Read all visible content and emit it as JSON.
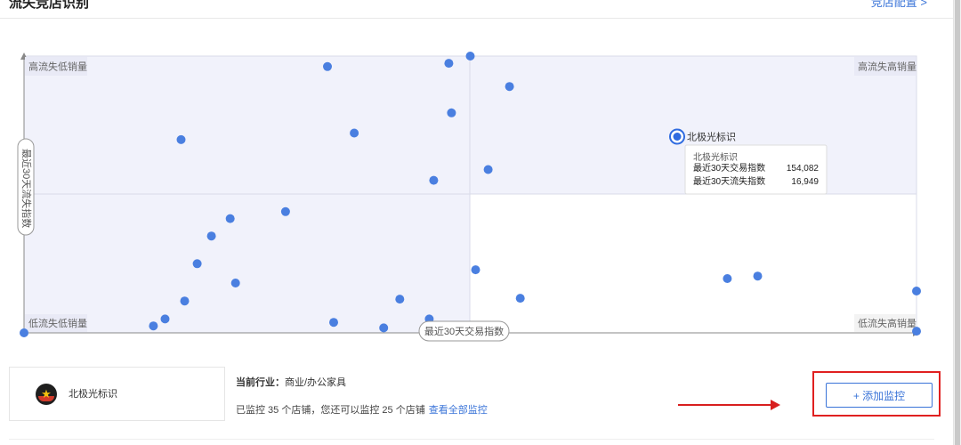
{
  "header": {
    "title": "流失竞店识别",
    "link": "竞店配置 >"
  },
  "chart_data": {
    "type": "scatter",
    "title": "",
    "xlabel": "最近30天交易指数",
    "ylabel": "最近30天流失指数",
    "quadrants": {
      "top_left": "高流失低销量",
      "top_right": "高流失高销量",
      "bottom_left": "低流失低销量",
      "bottom_right": "低流失高销量"
    },
    "colors": {
      "point": "#4a7fe0",
      "quadrant_fill": "#f1f2fb",
      "grid": "#d9dbe8"
    },
    "x_range": [
      0,
      1
    ],
    "y_range": [
      0,
      1
    ],
    "points": [
      {
        "x": 0.0,
        "y": 0.0
      },
      {
        "x": 0.145,
        "y": 0.025
      },
      {
        "x": 0.158,
        "y": 0.05
      },
      {
        "x": 0.18,
        "y": 0.115
      },
      {
        "x": 0.237,
        "y": 0.18
      },
      {
        "x": 0.194,
        "y": 0.25
      },
      {
        "x": 0.21,
        "y": 0.35
      },
      {
        "x": 0.231,
        "y": 0.413
      },
      {
        "x": 0.293,
        "y": 0.438
      },
      {
        "x": 0.176,
        "y": 0.698
      },
      {
        "x": 0.34,
        "y": 0.962
      },
      {
        "x": 0.37,
        "y": 0.722
      },
      {
        "x": 0.347,
        "y": 0.038
      },
      {
        "x": 0.403,
        "y": 0.018
      },
      {
        "x": 0.421,
        "y": 0.122
      },
      {
        "x": 0.454,
        "y": 0.05
      },
      {
        "x": 0.459,
        "y": 0.551
      },
      {
        "x": 0.476,
        "y": 0.974
      },
      {
        "x": 0.479,
        "y": 0.795
      },
      {
        "x": 0.5,
        "y": 1.0
      },
      {
        "x": 0.506,
        "y": 0.228
      },
      {
        "x": 0.52,
        "y": 0.59
      },
      {
        "x": 0.544,
        "y": 0.89
      },
      {
        "x": 0.556,
        "y": 0.125
      },
      {
        "x": 0.788,
        "y": 0.196
      },
      {
        "x": 0.822,
        "y": 0.205
      },
      {
        "x": 1.0,
        "y": 0.151
      },
      {
        "x": 1.0,
        "y": 0.006
      }
    ],
    "highlight": {
      "name": "北极光标识",
      "x": 0.732,
      "y": 0.708,
      "tooltip": {
        "title": "北极光标识",
        "rows": [
          {
            "label": "最近30天交易指数",
            "value": "154,082"
          },
          {
            "label": "最近30天流失指数",
            "value": "16,949"
          }
        ]
      }
    }
  },
  "store": {
    "name": "北极光标识"
  },
  "info": {
    "industry_label": "当前行业：",
    "industry_value": "商业/办公家具",
    "quota_text": "已监控 35 个店铺，您还可以监控 25 个店铺",
    "view_all": "查看全部监控"
  },
  "actions": {
    "add_monitor": "+ 添加监控"
  }
}
